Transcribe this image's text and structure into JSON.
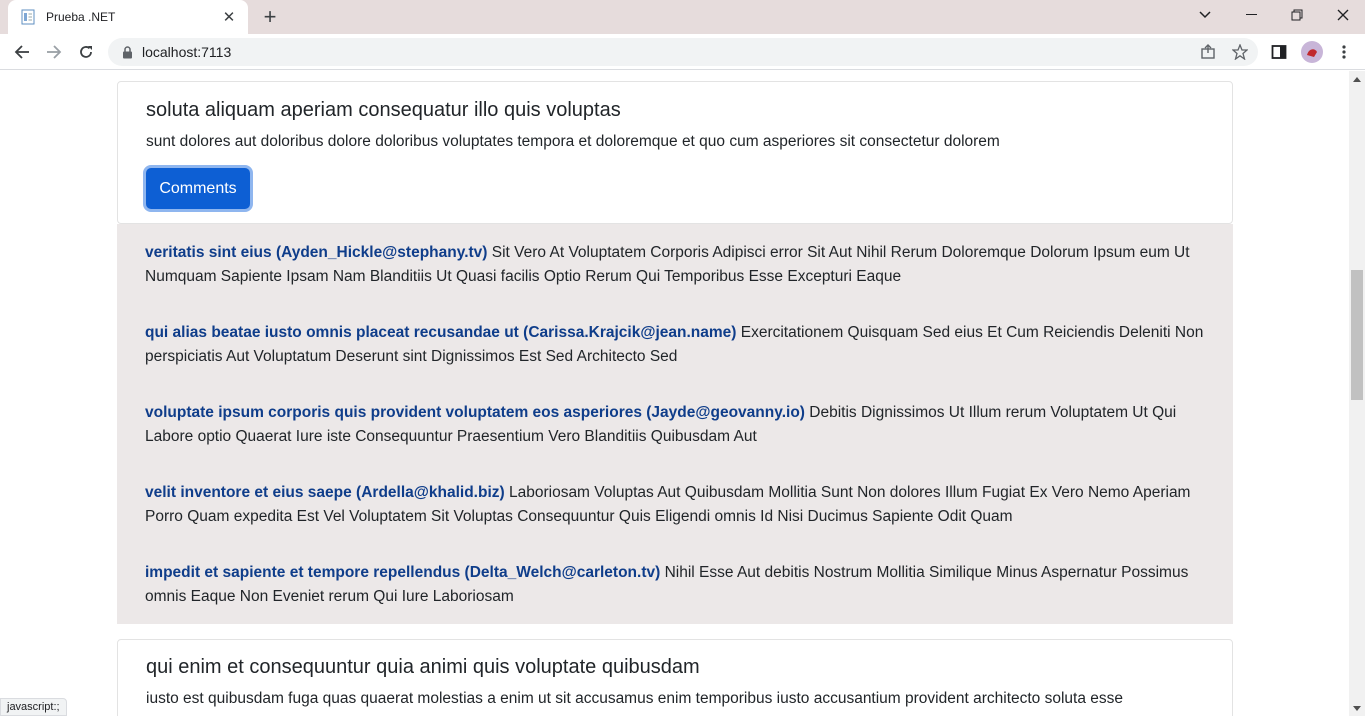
{
  "browser": {
    "tab_title": "Prueba .NET",
    "url": "localhost:7113",
    "status_text": "javascript:;"
  },
  "posts": [
    {
      "title": "soluta aliquam aperiam consequatur illo quis voluptas",
      "body": "sunt dolores aut doloribus dolore doloribus voluptates tempora et doloremque et quo cum asperiores sit consectetur dolorem",
      "button_label": "Comments"
    },
    {
      "title": "qui enim et consequuntur quia animi quis voluptate quibusdam",
      "body": "iusto est quibusdam fuga quas quaerat molestias a enim ut sit accusamus enim temporibus iusto accusantium provident architecto soluta esse"
    }
  ],
  "comments": [
    {
      "author": "veritatis sint eius (Ayden_Hickle@stephany.tv)",
      "text": "Sit Vero At Voluptatem Corporis Adipisci error Sit Aut Nihil Rerum Doloremque Dolorum Ipsum eum Ut Numquam Sapiente Ipsam Nam Blanditiis Ut Quasi facilis Optio Rerum Qui Temporibus Esse Excepturi Eaque"
    },
    {
      "author": "qui alias beatae iusto omnis placeat recusandae ut (Carissa.Krajcik@jean.name)",
      "text": "Exercitationem Quisquam Sed eius Et Cum Reiciendis Deleniti Non perspiciatis Aut Voluptatum Deserunt sint Dignissimos Est Sed Architecto Sed"
    },
    {
      "author": "voluptate ipsum corporis quis provident voluptatem eos asperiores (Jayde@geovanny.io)",
      "text": "Debitis Dignissimos Ut Illum rerum Voluptatem Ut Qui Labore optio Quaerat Iure iste Consequuntur Praesentium Vero Blanditiis Quibusdam Aut"
    },
    {
      "author": "velit inventore et eius saepe (Ardella@khalid.biz)",
      "text": "Laboriosam Voluptas Aut Quibusdam Mollitia Sunt Non dolores Illum Fugiat Ex Vero Nemo Aperiam Porro Quam expedita Est Vel Voluptatem Sit Voluptas Consequuntur Quis Eligendi omnis Id Nisi Ducimus Sapiente Odit Quam"
    },
    {
      "author": "impedit et sapiente et tempore repellendus (Delta_Welch@carleton.tv)",
      "text": "Nihil Esse Aut debitis Nostrum Mollitia Similique Minus Aspernatur Possimus omnis Eaque Non Eveniet rerum Qui Iure Laboriosam"
    }
  ],
  "colors": {
    "primary_button": "#0d5fd4",
    "comment_author": "#0f3d8a",
    "comments_panel_bg": "#ece8e8"
  }
}
